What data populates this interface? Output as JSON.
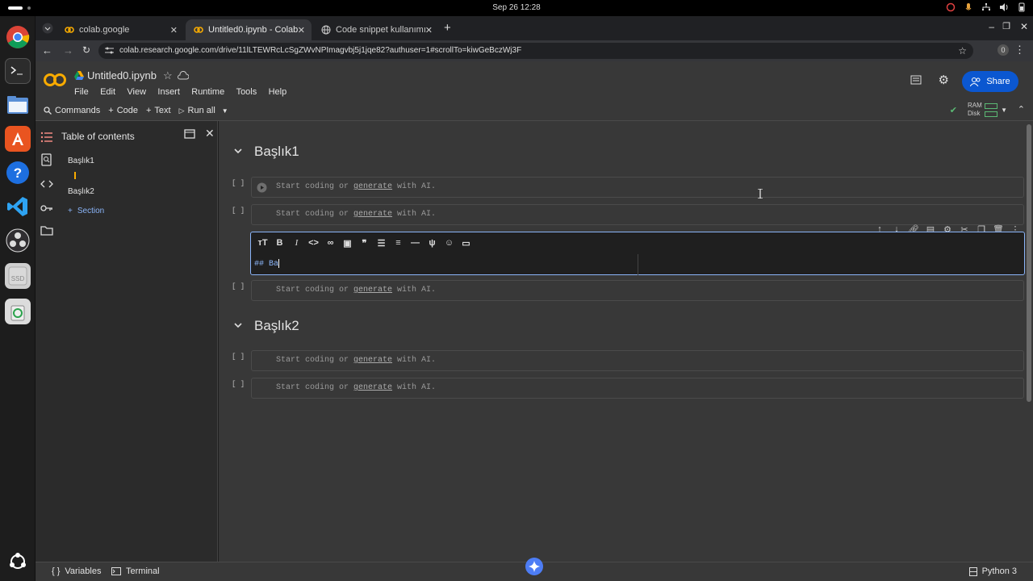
{
  "system": {
    "clock": "Sep 26  12:28"
  },
  "tabs": [
    {
      "label": "colab.google",
      "active": false
    },
    {
      "label": "Untitled0.ipynb - Colab",
      "active": true
    },
    {
      "label": "Code snippet kullanımı",
      "active": false
    }
  ],
  "url": "colab.research.google.com/drive/11lLTEWRcLcSgZWvNPImagvbj5j1jqe82?authuser=1#scrollTo=kiwGeBczWj3F",
  "profile_badge": "0",
  "notebook": {
    "title": "Untitled0.ipynb",
    "menu": [
      "File",
      "Edit",
      "View",
      "Insert",
      "Runtime",
      "Tools",
      "Help"
    ],
    "toolbar": {
      "commands": "Commands",
      "code": "Code",
      "text": "Text",
      "run_all": "Run all"
    },
    "share": "Share",
    "ram": "RAM",
    "disk": "Disk"
  },
  "toc": {
    "title": "Table of contents",
    "items": [
      "Başlık1",
      "Başlık2"
    ],
    "add_section": "Section"
  },
  "sections": [
    {
      "heading": "Başlık1"
    },
    {
      "heading": "Başlık2"
    }
  ],
  "cell": {
    "bracket": "[ ]",
    "placeholder_start": "Start coding or ",
    "placeholder_link": "generate",
    "placeholder_end": " with AI."
  },
  "editor": {
    "text": "## Ba"
  },
  "status": {
    "variables": "Variables",
    "terminal": "Terminal",
    "kernel": "Python 3"
  }
}
